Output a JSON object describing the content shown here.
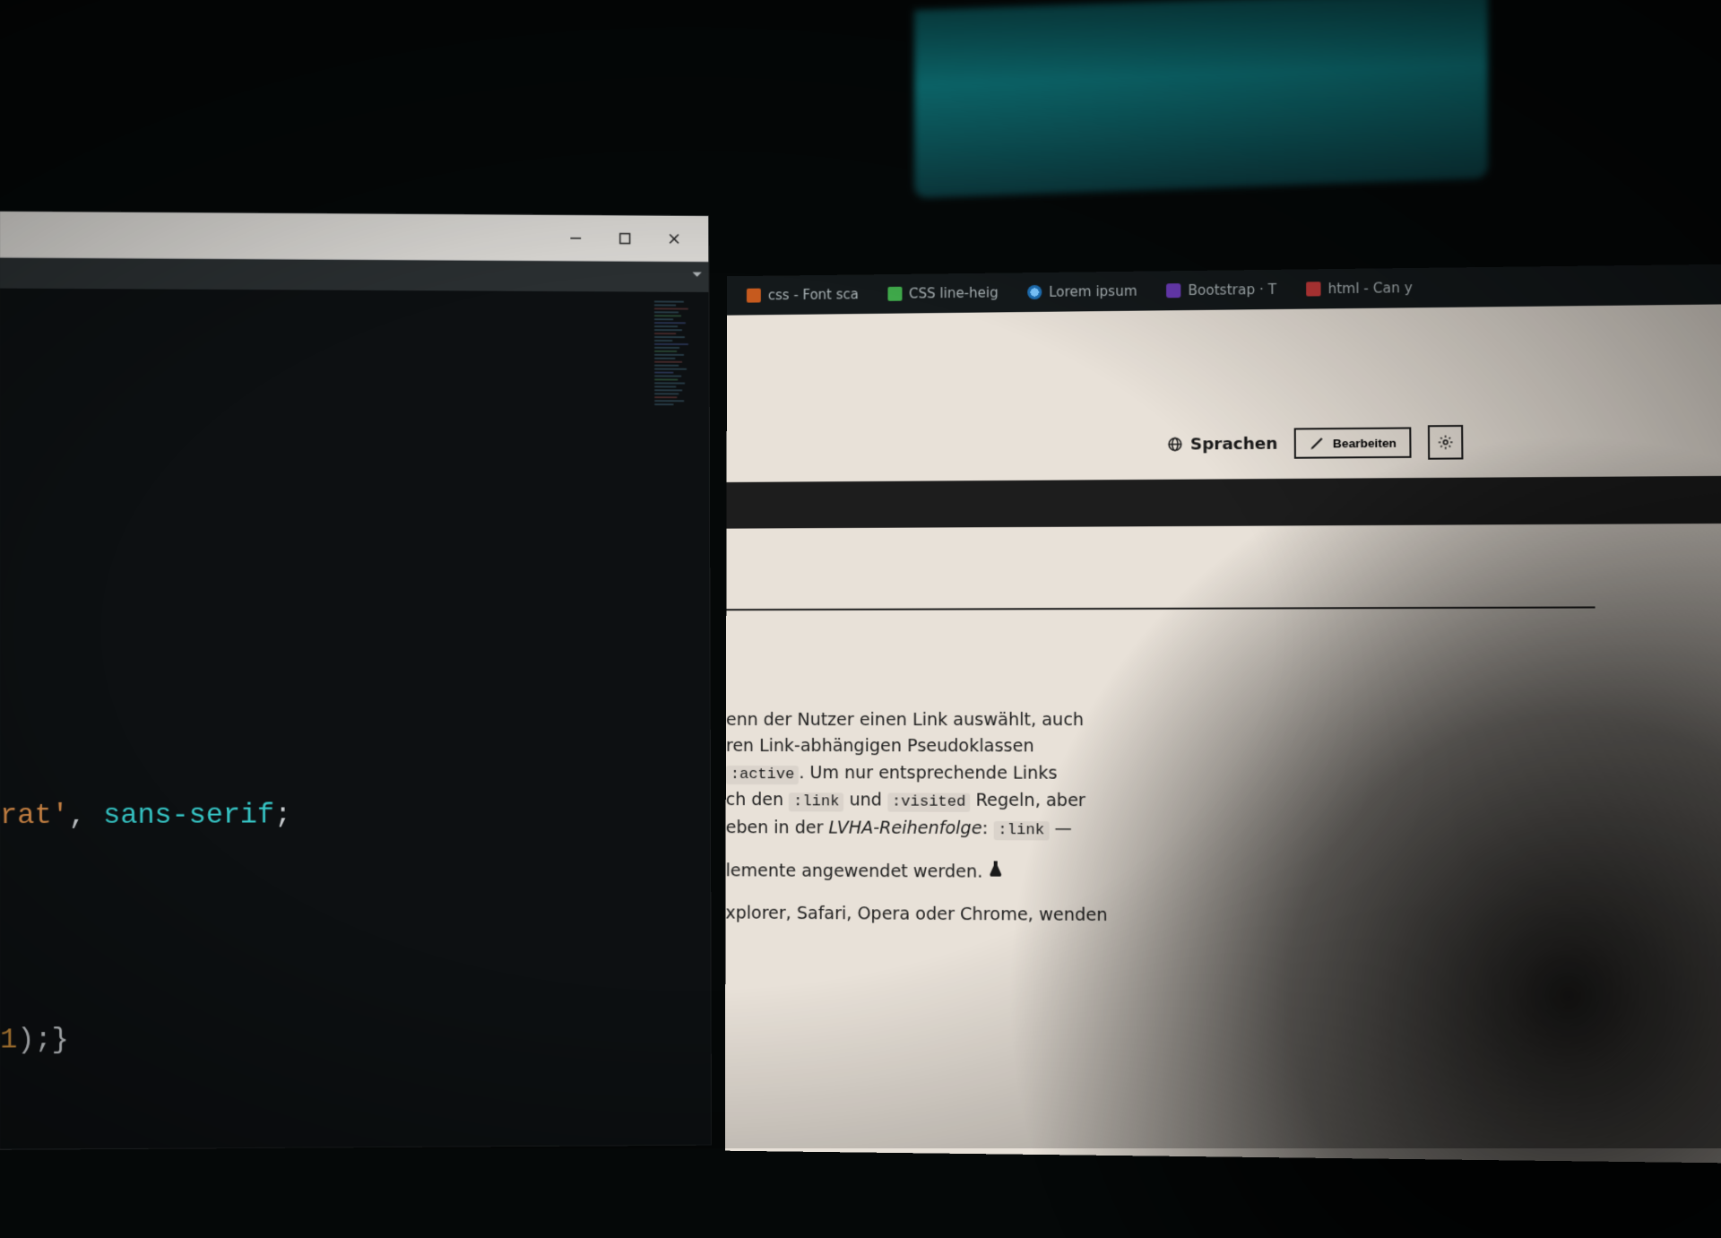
{
  "editor": {
    "code_line_1": {
      "str": "rat'",
      "punct1": ", ",
      "kw": "sans-serif",
      "punct2": ";"
    },
    "code_line_2": {
      "num": "1",
      "rest": ");}"
    }
  },
  "browser": {
    "tabs": [
      {
        "label": "css - Font sca"
      },
      {
        "label": "CSS line-heig"
      },
      {
        "label": "Lorem ipsum"
      },
      {
        "label": "Bootstrap · T"
      },
      {
        "label": "html - Can y"
      }
    ],
    "actions": {
      "languages": "Sprachen",
      "edit": "Bearbeiten"
    },
    "article": {
      "p1_a": "enn der Nutzer einen Link auswählt, auch",
      "p1_b": "ren Link-abhängigen Pseudoklassen",
      "p1_c_pre": "",
      "p1_c_code": ":active",
      "p1_c_post": ". Um nur entsprechende Links",
      "p1_d_pre": "ch den ",
      "p1_d_code1": ":link",
      "p1_d_mid": " und ",
      "p1_d_code2": ":visited",
      "p1_d_post": " Regeln, aber",
      "p1_e_pre": "eben in der ",
      "p1_e_em": "LVHA-Reihenfolge",
      "p1_e_post": ": ",
      "p1_e_code": ":link",
      "p1_e_dash": " —",
      "p2": "lemente angewendet werden.",
      "p3": "xplorer, Safari, Opera oder Chrome, wenden"
    }
  }
}
